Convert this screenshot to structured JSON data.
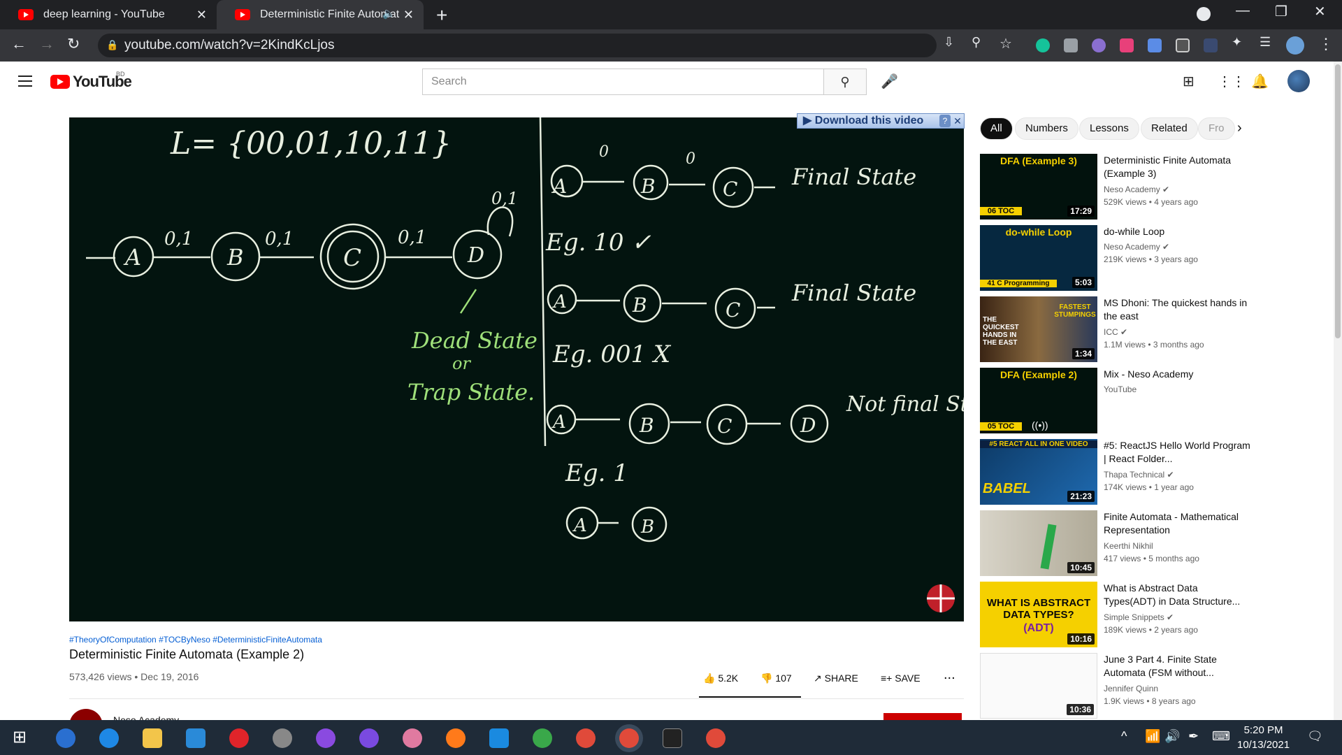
{
  "browser": {
    "tabs": [
      {
        "title": "deep learning - YouTube"
      },
      {
        "title": "Deterministic Finite Automat"
      }
    ],
    "new_tab": "+",
    "url": "youtube.com/watch?v=2KindKcLjos",
    "window": {
      "minimize": "—",
      "restore": "❐",
      "close": "✕"
    }
  },
  "youtube": {
    "logo": "YouTube",
    "country": "BD",
    "search_placeholder": "Search"
  },
  "video": {
    "download_bar": "▶ Download this video",
    "hashtags": "#TheoryOfComputation #TOCByNeso #DeterministicFiniteAutomata",
    "title": "Deterministic Finite Automata (Example 2)",
    "meta": "573,426 views • Dec 19, 2016",
    "likes": "5.2K",
    "dislikes": "107",
    "share": "SHARE",
    "save": "SAVE",
    "more": "...",
    "channel": "Neso Academy",
    "board": {
      "language": "L= {00,01,10,11}",
      "input_labels": [
        "0,1",
        "0,1",
        "0,1",
        "0,1"
      ],
      "states": [
        "A",
        "B",
        "C",
        "D"
      ],
      "dead1": "Dead State",
      "or": "or",
      "dead2": "Trap State.",
      "eg1": "Eg. 10 ✓",
      "eg2": "Eg. 001  X",
      "eg3": "Eg. 1",
      "final": "Final State",
      "final2": "Final State",
      "notfinal": "Not final State",
      "top_zero": "0",
      "top_zero2": "0"
    }
  },
  "chips": [
    "All",
    "Numbers",
    "Lessons",
    "Related",
    "Fro"
  ],
  "recommendations": [
    {
      "title": "Deterministic Finite Automata (Example 3)",
      "channel": "Neso Academy",
      "verified": true,
      "meta": "529K views • 4 years ago",
      "duration": "17:29",
      "thumb_label": "DFA (Example 3)",
      "thumb_badge": "06 TOC"
    },
    {
      "title": "do-while Loop",
      "channel": "Neso Academy",
      "verified": true,
      "meta": "219K views • 3 years ago",
      "duration": "5:03",
      "thumb_label": "do-while Loop",
      "thumb_badge": "41 C Programming"
    },
    {
      "title": "MS Dhoni: The quickest hands in the east",
      "channel": "ICC",
      "verified": true,
      "meta": "1.1M views • 3 months ago",
      "duration": "1:34",
      "thumb_label": "THE QUICKEST HANDS IN THE EAST",
      "thumb_badge": "FASTEST STUMPINGS"
    },
    {
      "title": "Mix - Neso Academy",
      "channel": "YouTube",
      "verified": false,
      "meta": "",
      "duration": "",
      "thumb_label": "DFA (Example 2)",
      "thumb_badge": "05 TOC"
    },
    {
      "title": "#5: ReactJS Hello World Program | React Folder...",
      "channel": "Thapa Technical",
      "verified": true,
      "meta": "174K views • 1 year ago",
      "duration": "21:23",
      "thumb_label": "#5 REACT ALL IN ONE VIDEO",
      "thumb_badge": "BABEL"
    },
    {
      "title": "Finite Automata - Mathematical Representation",
      "channel": "Keerthi Nikhil",
      "verified": false,
      "meta": "417 views • 5 months ago",
      "duration": "10:45",
      "thumb_label": "",
      "thumb_badge": ""
    },
    {
      "title": "What is Abstract Data Types(ADT) in Data Structure...",
      "channel": "Simple Snippets",
      "verified": true,
      "meta": "189K views • 2 years ago",
      "duration": "10:16",
      "thumb_label": "WHAT IS ABSTRACT DATA TYPES?",
      "thumb_badge": "(ADT)"
    },
    {
      "title": "June 3 Part 4. Finite State Automata (FSM without...",
      "channel": "Jennifer Quinn",
      "verified": false,
      "meta": "1.9K views • 8 years ago",
      "duration": "10:36",
      "thumb_label": "",
      "thumb_badge": ""
    }
  ],
  "taskbar": {
    "time": "5:20 PM",
    "date": "10/13/2021"
  },
  "colors": {
    "chalk_green": "#9fe07a",
    "chalk_white": "#e8efe0",
    "youtube_red": "#ff0000",
    "chrome_dark": "#202124"
  }
}
